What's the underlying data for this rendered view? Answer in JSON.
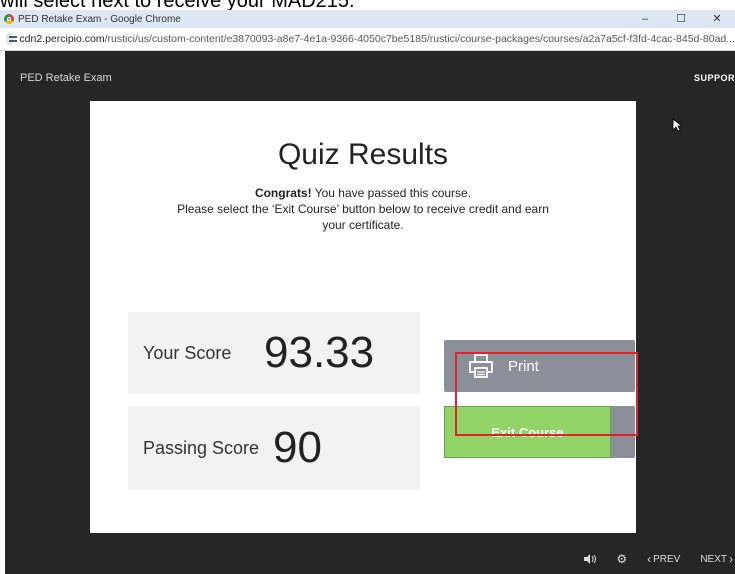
{
  "caption": "will select next to receive your MAD215.",
  "window": {
    "title": "PED Retake Exam - Google Chrome",
    "minimize": "–",
    "maximize": "☐",
    "close": "✕"
  },
  "address": {
    "host": "cdn2.percipio.com",
    "path": "/rustici/us/custom-content/e3870093-a8e7-4e1a-9366-4050c7be5185/rustici/course-packages/courses/a2a7a5cf-f3fd-4cac-845d-80ad..."
  },
  "app": {
    "title": "PED Retake Exam",
    "support_label": "SUPPOR"
  },
  "results": {
    "title": "Quiz Results",
    "congrats_bold": "Congrats!",
    "congrats_rest": " You have passed this course.",
    "instruction_line1": "Please select the ‘Exit Course’ button below to receive credit and earn",
    "instruction_line2": "your certificate.",
    "your_score_label": "Your Score",
    "your_score_value": "93.33",
    "passing_score_label": "Passing Score",
    "passing_score_value": "90",
    "print_label": "Print",
    "exit_label": "Exit Course"
  },
  "footer": {
    "volume_icon": "volume-icon",
    "settings_icon": "gear-icon",
    "prev_label": "PREV",
    "next_label": "NEXT"
  },
  "colors": {
    "app_bg": "#262626",
    "exit_green": "#92d468",
    "print_gray": "#8a8f99",
    "highlight_red": "#e0232a"
  }
}
